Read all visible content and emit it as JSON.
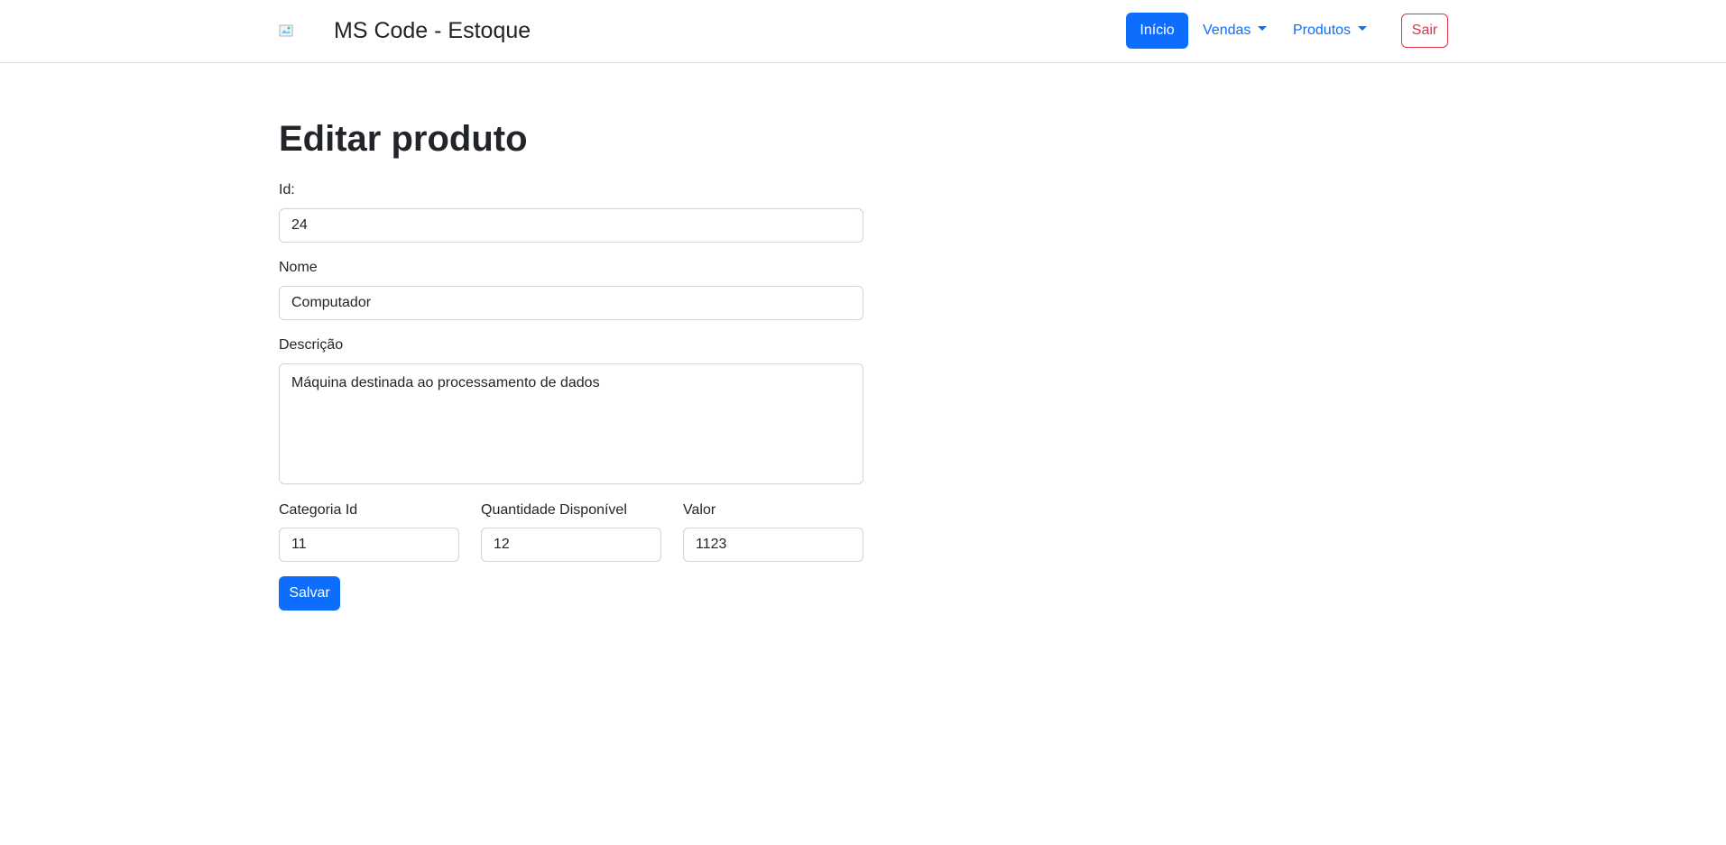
{
  "navbar": {
    "brand_text": "MS Code - Estoque",
    "home_label": "Início",
    "sales_label": "Vendas",
    "products_label": "Produtos",
    "logout_label": "Sair"
  },
  "page": {
    "title": "Editar produto"
  },
  "form": {
    "id_label": "Id:",
    "id_value": "24",
    "name_label": "Nome",
    "name_value": "Computador",
    "description_label": "Descrição",
    "description_value": "Máquina destinada ao processamento de dados",
    "category_label": "Categoria Id",
    "category_value": "11",
    "quantity_label": "Quantidade Disponível",
    "quantity_value": "12",
    "price_label": "Valor",
    "price_value": "1123",
    "save_label": "Salvar"
  },
  "colors": {
    "primary": "#0d6efd",
    "danger": "#dc3545",
    "border": "#ced4da"
  }
}
